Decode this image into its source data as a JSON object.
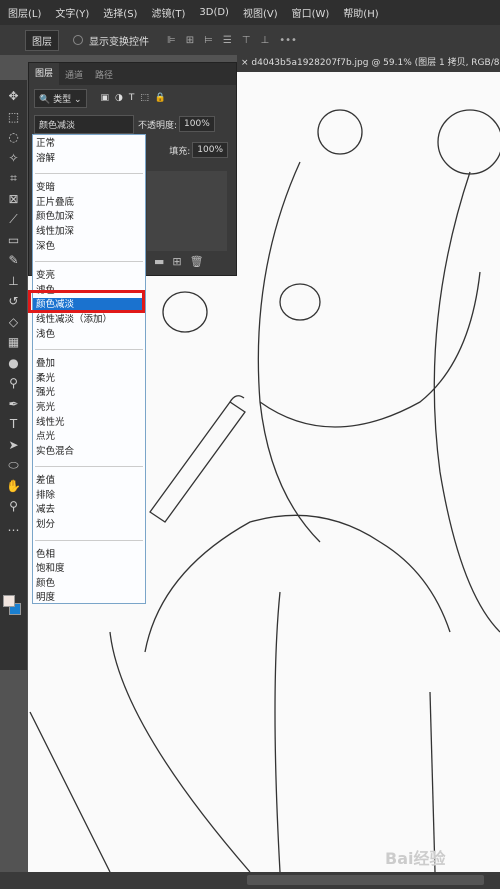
{
  "menubar": [
    "图层(L)",
    "文字(Y)",
    "选择(S)",
    "滤镜(T)",
    "3D(D)",
    "视图(V)",
    "窗口(W)",
    "帮助(H)"
  ],
  "options": {
    "select": "图层",
    "show_transform": "显示变换控件"
  },
  "doc_tab": "d4043b5a1928207f7b.jpg @ 59.1% (图层 1 拷贝, RGB/8)",
  "panel": {
    "tabs": [
      "图层",
      "通道",
      "路径"
    ],
    "filter": "类型",
    "blend_mode": "颜色减淡",
    "opacity_label": "不透明度:",
    "opacity": "100%",
    "fill_label": "填充:",
    "fill": "100%"
  },
  "blend_menu": {
    "groups": [
      [
        "正常",
        "溶解"
      ],
      [
        "变暗",
        "正片叠底",
        "颜色加深",
        "线性加深",
        "深色"
      ],
      [
        "变亮",
        "滤色",
        "颜色减淡",
        "线性减淡（添加）",
        "浅色"
      ],
      [
        "叠加",
        "柔光",
        "强光",
        "亮光",
        "线性光",
        "点光",
        "实色混合"
      ],
      [
        "差值",
        "排除",
        "减去",
        "划分"
      ],
      [
        "色相",
        "饱和度",
        "颜色",
        "明度"
      ]
    ],
    "selected": "颜色减淡"
  },
  "colors": {
    "highlight": "#1a72cf",
    "red_box": "#e01919",
    "foreground": "#f2e6e0",
    "background": "#1a7fd0"
  },
  "watermark": "Bai经验"
}
